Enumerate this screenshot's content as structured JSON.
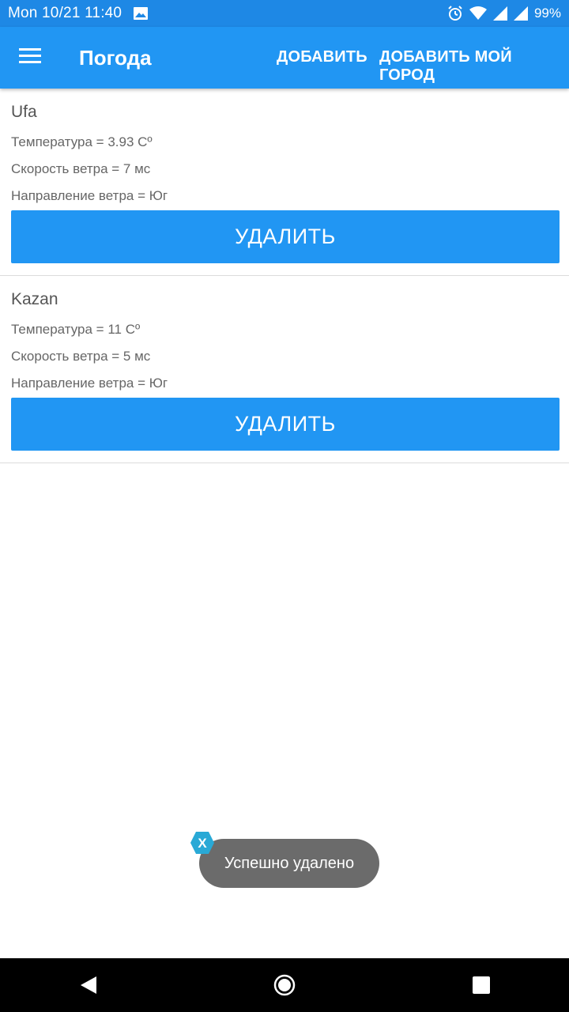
{
  "status_bar": {
    "time": "Mon 10/21 11:40",
    "battery": "99%",
    "icons": [
      "image-icon",
      "alarm-icon",
      "wifi-icon",
      "signal-icon",
      "battery-icon"
    ]
  },
  "app_bar": {
    "title": "Погода",
    "actions": [
      "ДОБАВИТЬ",
      "ДОБАВИТЬ МОЙ ГОРОД"
    ],
    "menu_icon": "menu-icon"
  },
  "cities": [
    {
      "name": "Ufa",
      "temperature": "Температура = 3.93 Cº",
      "wind_speed": "Скорость ветра = 7 мс",
      "wind_direction": "Направление ветра = Юг",
      "delete_label": "УДАЛИТЬ"
    },
    {
      "name": "Kazan",
      "temperature": "Температура = 11 Cº",
      "wind_speed": "Скорость ветра = 5 мс",
      "wind_direction": "Направление ветра = Юг",
      "delete_label": "УДАЛИТЬ"
    }
  ],
  "toast": {
    "message": "Успешно удалено",
    "badge": "X"
  },
  "nav_bar": {
    "icons": [
      "back-icon",
      "home-icon",
      "recent-apps-icon"
    ]
  },
  "colors": {
    "status_bar": "#1E88E5",
    "app_bar": "#2196F3",
    "button": "#2196F3",
    "toast": "#6b6b6b",
    "toast_badge": "#29A9D6"
  }
}
